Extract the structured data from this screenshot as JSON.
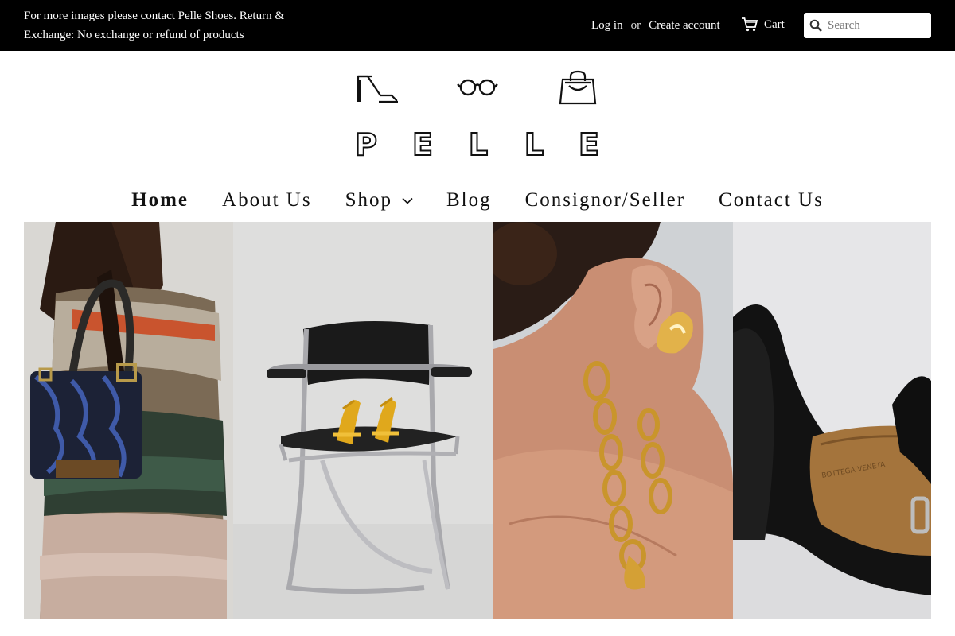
{
  "topbar": {
    "announcement": "For more images please contact Pelle Shoes. Return & Exchange: No exchange or refund of products",
    "login_label": "Log in",
    "or_label": "or",
    "create_account_label": "Create account",
    "cart_label": "Cart",
    "search_placeholder": "Search"
  },
  "logo": {
    "letters": [
      "P",
      "E",
      "L",
      "L",
      "E"
    ],
    "icons": [
      "heel-shoe-icon",
      "glasses-icon",
      "shopping-bag-icon"
    ]
  },
  "nav": {
    "items": [
      {
        "label": "Home",
        "active": true
      },
      {
        "label": "About Us"
      },
      {
        "label": "Shop",
        "has_dropdown": true
      },
      {
        "label": "Blog"
      },
      {
        "label": "Consignor/Seller"
      },
      {
        "label": "Contact Us"
      }
    ]
  },
  "hero": {
    "panels": [
      "model-with-handbag",
      "chair-with-gold-sandals",
      "woman-with-gold-jewelry",
      "black-leather-shoe"
    ],
    "shoe_insole_text": "BOTTEGA VENETA"
  },
  "colors": {
    "topbar_bg": "#000000",
    "topbar_text": "#ffffff",
    "page_bg": "#ffffff",
    "nav_text": "#111111"
  }
}
